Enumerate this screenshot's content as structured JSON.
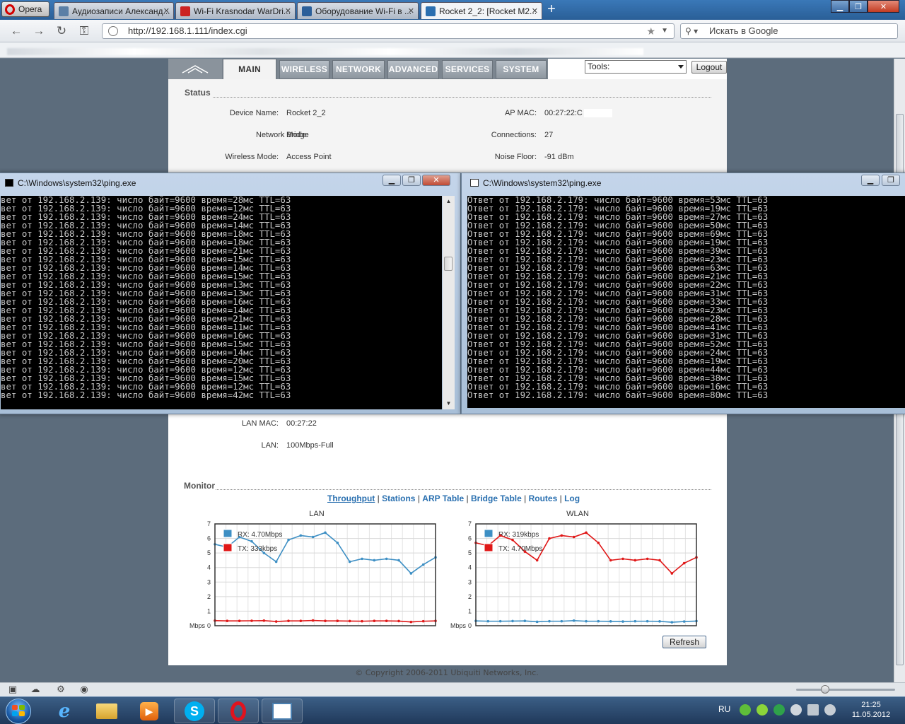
{
  "browser": {
    "menu_label": "Opera",
    "tabs": [
      {
        "title": "Аудиозаписи Александ...",
        "active": false,
        "icon": "vk-audio-icon"
      },
      {
        "title": "Wi-Fi Krasnodar WarDri...",
        "active": false,
        "icon": "lan-site-icon"
      },
      {
        "title": "Оборудование Wi-Fi в ...",
        "active": false,
        "icon": "forum-icon"
      },
      {
        "title": "Rocket 2_2: [Rocket M2...",
        "active": true,
        "icon": "rss-icon"
      }
    ],
    "new_tab_label": "+",
    "url": "http://192.168.1.111/index.cgi",
    "search_placeholder": "Искать в Google"
  },
  "router": {
    "nav": [
      "MAIN",
      "WIRELESS",
      "NETWORK",
      "ADVANCED",
      "SERVICES",
      "SYSTEM"
    ],
    "active_nav": "MAIN",
    "tools_label": "Tools:",
    "logout_label": "Logout",
    "status": {
      "title": "Status",
      "left": [
        {
          "label": "Device Name:",
          "value": "Rocket 2_2"
        },
        {
          "label": "Network Mode:",
          "value": "Bridge"
        },
        {
          "label": "Wireless Mode:",
          "value": "Access Point"
        }
      ],
      "right": [
        {
          "label": "AP MAC:",
          "value": "00:27:22:C"
        },
        {
          "label": "Connections:",
          "value": "27"
        },
        {
          "label": "Noise Floor:",
          "value": "-91 dBm"
        }
      ],
      "lower": [
        {
          "label": "LAN MAC:",
          "value": "00:27:22"
        },
        {
          "label": "LAN:",
          "value": "100Mbps-Full"
        }
      ]
    },
    "monitor": {
      "title": "Monitor",
      "links": [
        "Throughput",
        "Stations",
        "ARP Table",
        "Bridge Table",
        "Routes",
        "Log"
      ],
      "separator": "|",
      "refresh_label": "Refresh"
    },
    "copyright": "© Copyright 2006-2011 Ubiquiti Networks, Inc."
  },
  "chart_data": [
    {
      "type": "line",
      "title": "LAN",
      "ylabel": "Mbps",
      "ylim": [
        0,
        7
      ],
      "yticks": [
        0,
        1,
        2,
        3,
        4,
        5,
        6,
        7
      ],
      "series": [
        {
          "name": "RX: 4.70Mbps",
          "color": "#3d8fc4",
          "values": [
            5.6,
            5.4,
            6.1,
            5.8,
            5.0,
            4.4,
            5.9,
            6.2,
            6.1,
            6.4,
            5.7,
            4.4,
            4.6,
            4.5,
            4.6,
            4.5,
            3.6,
            4.2,
            4.7
          ]
        },
        {
          "name": "TX: 333kbps",
          "color": "#e01818",
          "values": [
            0.35,
            0.33,
            0.33,
            0.34,
            0.35,
            0.29,
            0.33,
            0.33,
            0.36,
            0.33,
            0.33,
            0.32,
            0.31,
            0.33,
            0.33,
            0.32,
            0.26,
            0.31,
            0.33
          ]
        }
      ]
    },
    {
      "type": "line",
      "title": "WLAN",
      "ylabel": "Mbps",
      "ylim": [
        0,
        7
      ],
      "yticks": [
        0,
        1,
        2,
        3,
        4,
        5,
        6,
        7
      ],
      "series": [
        {
          "name": "RX: 319kbps",
          "color": "#3d8fc4",
          "values": [
            0.33,
            0.31,
            0.31,
            0.32,
            0.33,
            0.27,
            0.31,
            0.31,
            0.35,
            0.31,
            0.31,
            0.3,
            0.29,
            0.31,
            0.31,
            0.3,
            0.24,
            0.29,
            0.32
          ]
        },
        {
          "name": "TX: 4.70Mbps",
          "color": "#e01818",
          "values": [
            5.7,
            5.5,
            6.2,
            5.9,
            5.1,
            4.5,
            6.0,
            6.2,
            6.1,
            6.4,
            5.7,
            4.5,
            4.6,
            4.5,
            4.6,
            4.5,
            3.6,
            4.3,
            4.7
          ]
        }
      ]
    }
  ],
  "console_left": {
    "title": "C:\\Windows\\system32\\ping.exe",
    "line_prefix": "вет от 192.168.2.139: число байт=9600 время=",
    "line_suffix": "мс TTL=63",
    "times": [
      28,
      12,
      24,
      14,
      18,
      18,
      21,
      15,
      14,
      15,
      13,
      13,
      16,
      14,
      21,
      11,
      16,
      15,
      14,
      20,
      12,
      15,
      12,
      42
    ]
  },
  "console_right": {
    "title": "C:\\Windows\\system32\\ping.exe",
    "line_prefix": "Ответ от 192.168.2.179: число байт=9600 время=",
    "line_suffix": "мс TTL=63",
    "times": [
      53,
      19,
      27,
      50,
      69,
      19,
      39,
      23,
      63,
      21,
      22,
      31,
      33,
      23,
      28,
      41,
      31,
      52,
      24,
      19,
      44,
      38,
      16,
      80
    ]
  },
  "taskbar": {
    "language": "RU",
    "time": "21:25",
    "date": "11.05.2012",
    "apps": [
      "ie-icon",
      "explorer-icon",
      "media-player-icon",
      "skype-icon",
      "opera-icon",
      "notepad-window-icon"
    ]
  },
  "colors": {
    "accent_link": "#2a70b0",
    "rx": "#3d8fc4",
    "tx": "#e01818",
    "console_bg": "#000000",
    "console_text": "#c8c8c8"
  }
}
